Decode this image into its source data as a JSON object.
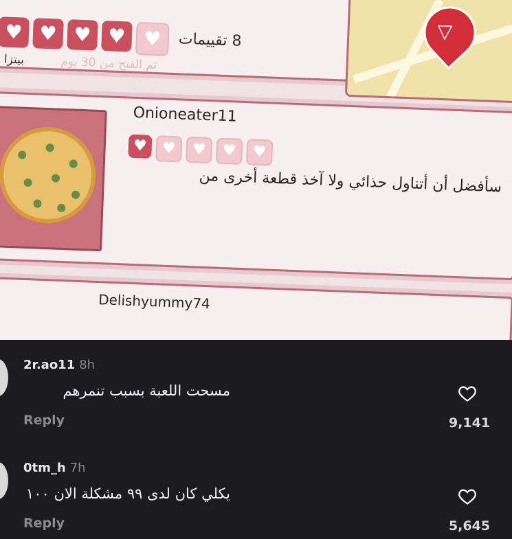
{
  "game": {
    "ratings_count": "8 تقييمات",
    "opened_text": "تم الفتح من 30 يوم",
    "pizza_tag": "بيتزا •",
    "top_hearts_filled": 4,
    "top_hearts_total": 5,
    "review": {
      "username": "Onioneater11",
      "hearts_filled": 1,
      "hearts_total": 5,
      "text": "سأفضل أن أتناول حذائي ولا آخذ قطعة أخرى من"
    },
    "next_username": "Delishyummy74"
  },
  "comments": [
    {
      "user": "2r.ao11",
      "time": "8h",
      "text": "مسحت اللعبة بسبب تنمرهم",
      "reply": "Reply",
      "likes": "9,141"
    },
    {
      "user": "0tm_h",
      "time": "7h",
      "text": "يكلي كان لدى ٩٩ مشكلة الان ١٠٠",
      "reply": "Reply",
      "likes": "5,645"
    }
  ],
  "icons": [
    "heart-icon",
    "pencil-icon",
    "map-pin-icon",
    "pizza-slice-icon"
  ],
  "colors": {
    "heart_red": "#c9505e",
    "background_dark": "#1c1c20",
    "card_border": "#b86b78"
  }
}
